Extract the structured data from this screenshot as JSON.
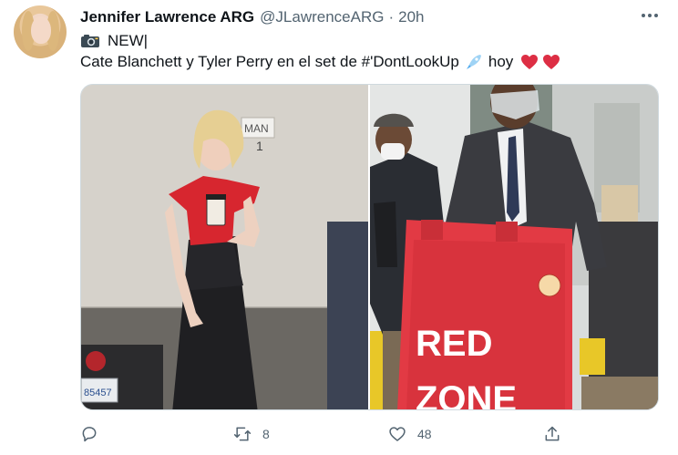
{
  "author": {
    "name": "Jennifer Lawrence ARG",
    "handle": "@JLawrenceARG",
    "separator": "·",
    "time": "20h"
  },
  "text": {
    "line1": "NEW|",
    "line2_main": "Cate Blanchett y Tyler Perry en el set de #'DontLookUp",
    "line2_end": "hoy"
  },
  "media": {
    "left_sign": "MAN",
    "left_sign_2": "1",
    "plate": "85457",
    "red_sign_line1": "RED",
    "red_sign_line2": "ZONE"
  },
  "actions": {
    "reply_count": "",
    "retweet_count": "8",
    "like_count": "48"
  },
  "icons": [
    "camera-icon",
    "rocket-icon",
    "heart-icon",
    "more-icon",
    "reply-icon",
    "retweet-icon",
    "like-icon",
    "share-icon"
  ],
  "colors": {
    "heart": "#e0245e",
    "text_secondary": "#536471",
    "sign_red": "#e23a44"
  }
}
